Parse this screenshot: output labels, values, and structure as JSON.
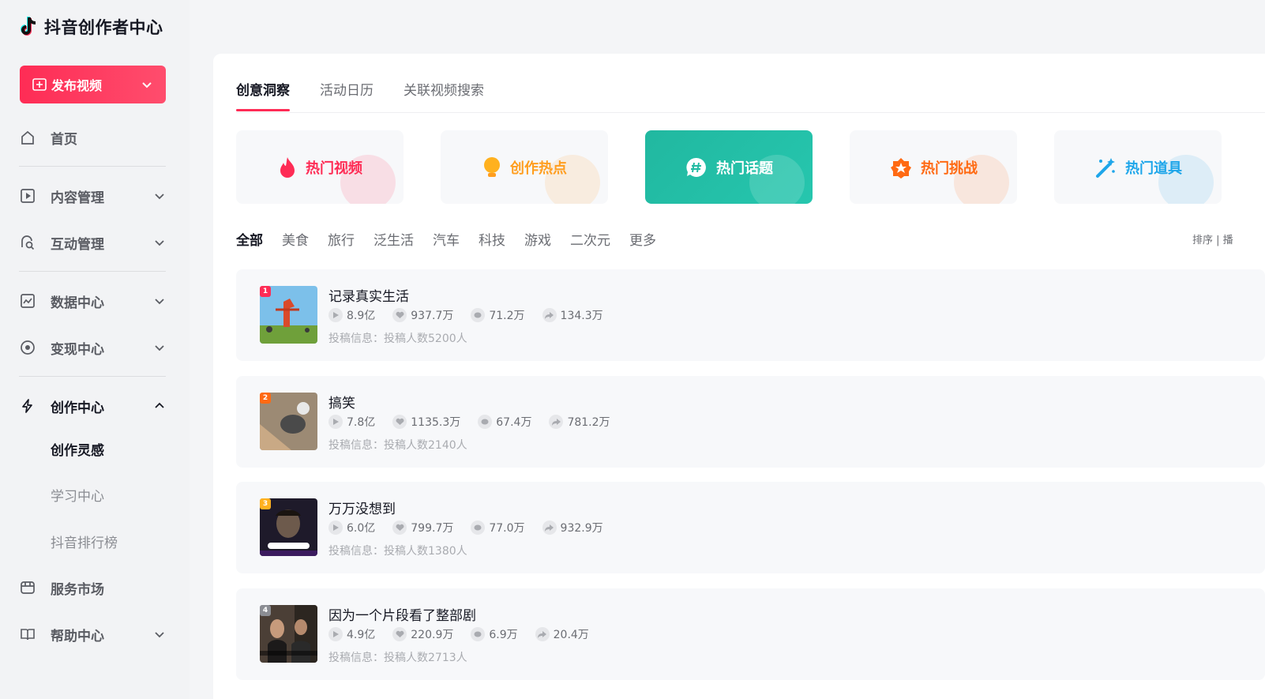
{
  "app": {
    "logo_text": "抖音创作者中心"
  },
  "sidebar": {
    "publish_label": "发布视频",
    "items": [
      {
        "label": "首页"
      },
      {
        "label": "内容管理"
      },
      {
        "label": "互动管理"
      },
      {
        "label": "数据中心"
      },
      {
        "label": "变现中心"
      },
      {
        "label": "创作中心"
      },
      {
        "label": "服务市场"
      },
      {
        "label": "帮助中心"
      }
    ],
    "sub_items": [
      {
        "label": "创作灵感"
      },
      {
        "label": "学习中心"
      },
      {
        "label": "抖音排行榜"
      }
    ]
  },
  "main": {
    "tabs": [
      {
        "label": "创意洞察"
      },
      {
        "label": "活动日历"
      },
      {
        "label": "关联视频搜索"
      }
    ],
    "cards": [
      {
        "label": "热门视频",
        "color": "#fe2c55"
      },
      {
        "label": "创作热点",
        "color": "#ff9e1f"
      },
      {
        "label": "热门话题",
        "color": "#ffffff"
      },
      {
        "label": "热门挑战",
        "color": "#ff6a13"
      },
      {
        "label": "热门道具",
        "color": "#1ea6ea"
      }
    ],
    "filters": [
      "全部",
      "美食",
      "旅行",
      "泛生活",
      "汽车",
      "科技",
      "游戏",
      "二次元",
      "更多"
    ],
    "sort_label": "排序 | 播",
    "rows": [
      {
        "rank": "1",
        "title": "记录真实生活",
        "plays": "8.9亿",
        "likes": "937.7万",
        "comments": "71.2万",
        "shares": "134.3万",
        "info": "投稿信息：投稿人数5200人"
      },
      {
        "rank": "2",
        "title": "搞笑",
        "plays": "7.8亿",
        "likes": "1135.3万",
        "comments": "67.4万",
        "shares": "781.2万",
        "info": "投稿信息：投稿人数2140人"
      },
      {
        "rank": "3",
        "title": "万万没想到",
        "plays": "6.0亿",
        "likes": "799.7万",
        "comments": "77.0万",
        "shares": "932.9万",
        "info": "投稿信息：投稿人数1380人"
      },
      {
        "rank": "4",
        "title": "因为一个片段看了整部剧",
        "plays": "4.9亿",
        "likes": "220.9万",
        "comments": "6.9万",
        "shares": "20.4万",
        "info": "投稿信息：投稿人数2713人"
      }
    ]
  }
}
